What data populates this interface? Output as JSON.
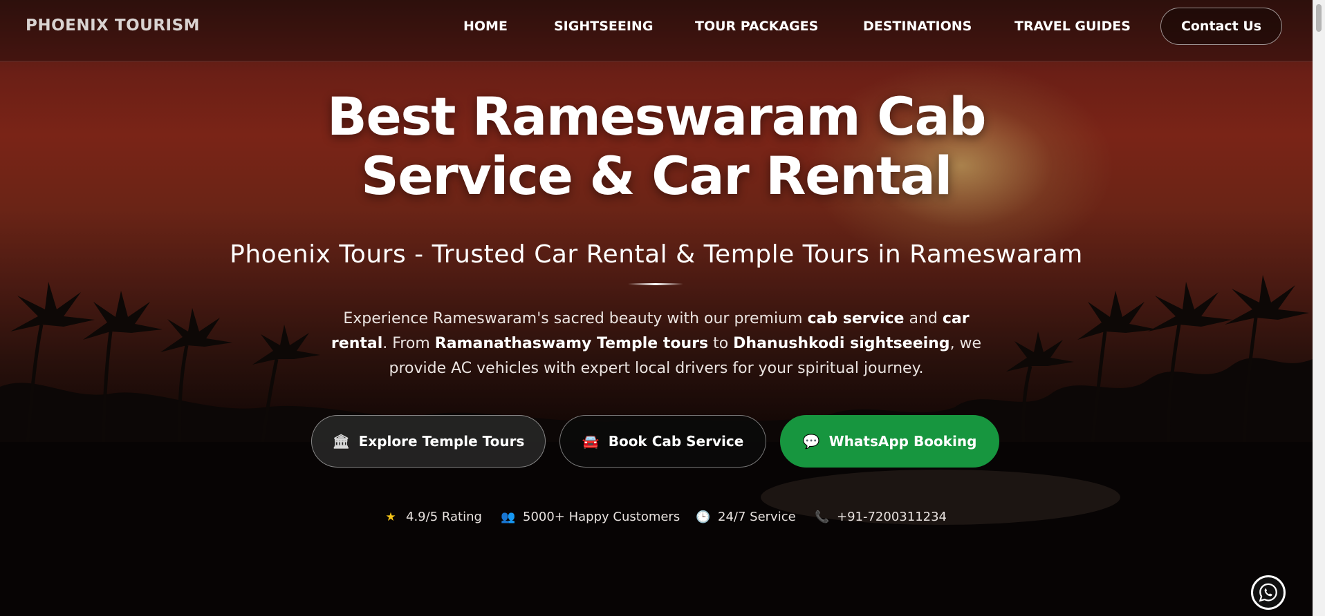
{
  "nav": {
    "brand": "PHOENIX TOURISM",
    "items": [
      {
        "label": "HOME"
      },
      {
        "label": "SIGHTSEEING"
      },
      {
        "label": "TOUR PACKAGES"
      },
      {
        "label": "DESTINATIONS"
      },
      {
        "label": "TRAVEL GUIDES"
      }
    ],
    "contact_label": "Contact Us"
  },
  "hero": {
    "title_line1": "Best Rameswaram Cab",
    "title_line2": "Service & Car Rental",
    "subtitle": "Phoenix Tours - Trusted Car Rental & Temple Tours in Rameswaram",
    "desc": {
      "t1": "Experience Rameswaram's sacred beauty with our premium ",
      "b1": "cab service",
      "t2": " and ",
      "b2": "car rental",
      "t3": ". From ",
      "b3": "Ramanathaswamy Temple tours",
      "t4": " to ",
      "b4": "Dhanushkodi sightseeing",
      "t5": ", we provide AC vehicles with expert local drivers for your spiritual journey."
    }
  },
  "cta": {
    "temple": {
      "icon": "temple-icon",
      "label": "Explore Temple Tours"
    },
    "cab": {
      "icon": "car-icon",
      "label": "Book Cab Service"
    },
    "whatsapp": {
      "icon": "chat-bubble-icon",
      "label": "WhatsApp Booking",
      "color": "#17963f"
    }
  },
  "stats": [
    {
      "icon": "star-icon",
      "label": "4.9/5 Rating"
    },
    {
      "icon": "people-icon",
      "label": "5000+ Happy Customers"
    },
    {
      "icon": "clock-icon",
      "label": "24/7 Service"
    },
    {
      "icon": "phone-icon",
      "label": "+91-7200311234"
    }
  ],
  "colors": {
    "accent_green": "#17963f",
    "hero_red": "#7a2417"
  }
}
